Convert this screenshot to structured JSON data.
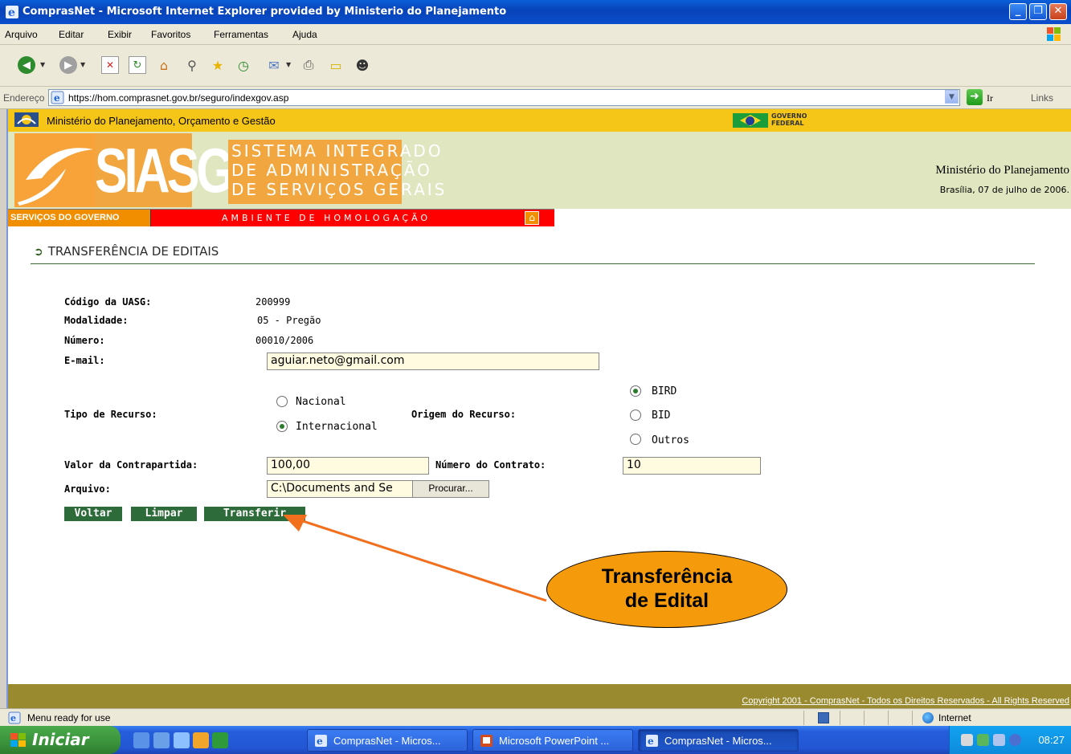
{
  "window": {
    "title": "ComprasNet - Microsoft Internet Explorer provided by Ministerio do Planejamento",
    "controls": [
      "_",
      "🗗",
      "✕"
    ]
  },
  "menu": [
    "Arquivo",
    "Editar",
    "Exibir",
    "Favoritos",
    "Ferramentas",
    "Ajuda"
  ],
  "address": {
    "label": "Endereço",
    "url": "https://hom.comprasnet.gov.br/seguro/indexgov.asp",
    "go_label": "Ir",
    "links_label": "Links"
  },
  "site": {
    "ministry_bar_text": "Ministério do Planejamento, Orçamento e Gestão",
    "gov_brand": [
      "GOVERNO",
      "FEDERAL"
    ],
    "logo_acronym": "SIASG",
    "logo_full": [
      "SISTEMA INTEGRADO",
      "DE ADMINISTRAÇÃO",
      "DE SERVIÇOS GERAIS"
    ],
    "header_ministry": "Ministério do Planejamento",
    "header_date": "Brasília, 07 de julho de 2006.",
    "services_label": "SERVIÇOS DO GOVERNO",
    "environment_label": "AMBIENTE DE HOMOLOGAÇÃO",
    "footer_copyright": "Copyright 2001 - ComprasNet - Todos os Direitos Reservados - All Rights Reserved"
  },
  "form": {
    "section_title": "TRANSFERÊNCIA DE EDITAIS",
    "uasg_label": "Código da UASG:",
    "uasg_value": "200999",
    "modalidade_label": "Modalidade:",
    "modalidade_value": "05 - Pregão",
    "numero_label": "Número:",
    "numero_value": "00010/2006",
    "email_label": "E-mail:",
    "email_value": "aguiar.neto@gmail.com",
    "tipo_label": "Tipo de Recurso:",
    "tipo_options": [
      {
        "label": "Nacional",
        "selected": false
      },
      {
        "label": "Internacional",
        "selected": true
      }
    ],
    "origem_label": "Origem do Recurso:",
    "origem_options": [
      {
        "label": "BIRD",
        "selected": true
      },
      {
        "label": "BID",
        "selected": false
      },
      {
        "label": "Outros",
        "selected": false
      }
    ],
    "contrapartida_label": "Valor da Contrapartida:",
    "contrapartida_value": "100,00",
    "contrato_label": "Número do Contrato:",
    "contrato_value": "10",
    "arquivo_label": "Arquivo:",
    "arquivo_value": "C:\\Documents and Se",
    "browse_label": "Procurar...",
    "btn_voltar": "Voltar",
    "btn_limpar": "Limpar",
    "btn_transferir": "Transferir"
  },
  "callout": {
    "line1": "Transferência",
    "line2": "de Edital",
    "color": "#f59a0a"
  },
  "status": {
    "text": "Menu ready for use",
    "zone": "Internet"
  },
  "taskbar": {
    "start_label": "Iniciar",
    "tasks": [
      "ComprasNet - Micros...",
      "Microsoft PowerPoint ...",
      "ComprasNet - Micros..."
    ],
    "clock": "08:27"
  }
}
